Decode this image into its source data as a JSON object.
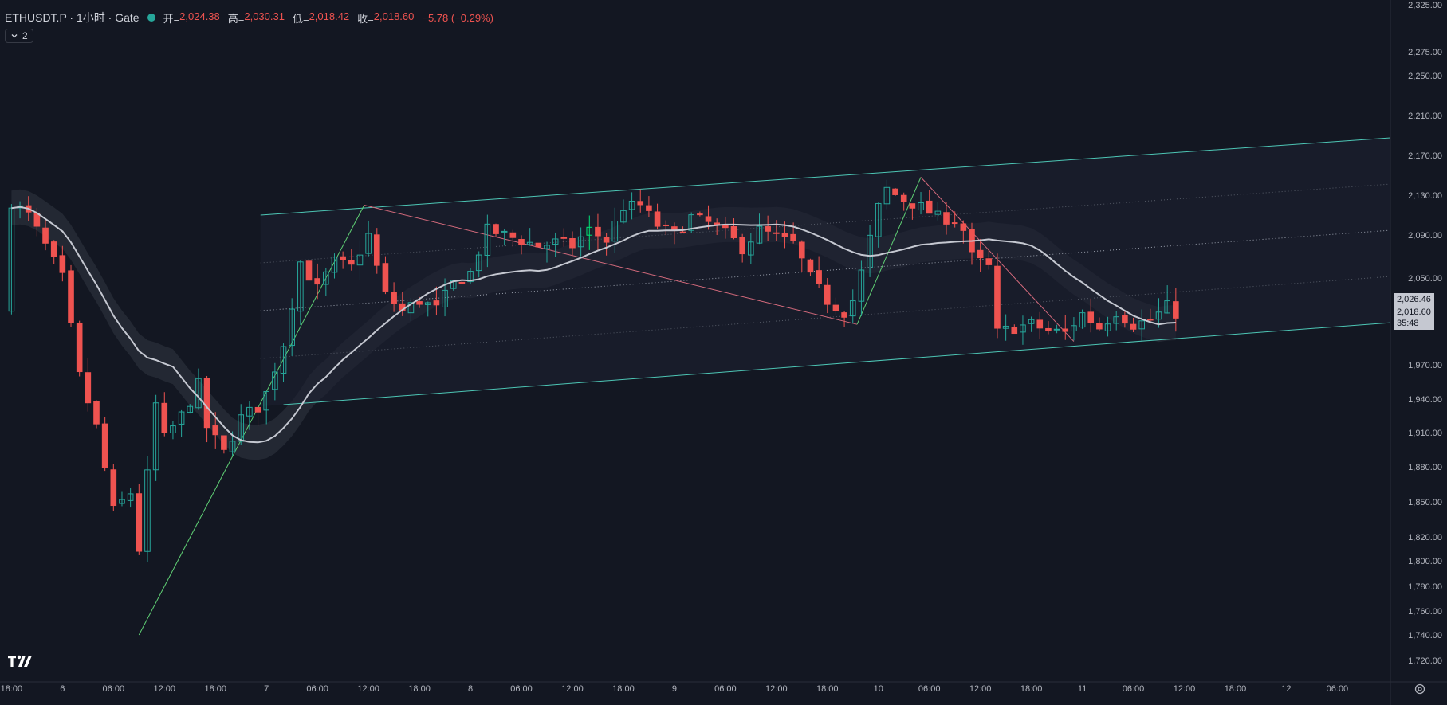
{
  "legend": {
    "symbol": "ETHUSDT.P · 1小时 · Gate",
    "open_label": "开=",
    "open": "2,024.38",
    "high_label": "高=",
    "high": "2,030.31",
    "low_label": "低=",
    "low": "2,018.42",
    "close_label": "收=",
    "close": "2,018.60",
    "change": "−5.78 (−0.29%)",
    "status_color": "#26a69a"
  },
  "indicator_toggle": {
    "icon": "chevron-down-icon",
    "count": "2"
  },
  "price_tags": {
    "ma": "2,026.46",
    "last": "2,018.60",
    "countdown": "35:48"
  },
  "icons": {
    "logo": "tradingview-logo",
    "settings": "gear-icon"
  },
  "chart_data": {
    "type": "candlestick",
    "y_axis_ticks": [
      "2,325.00",
      "2,275.00",
      "2,250.00",
      "2,210.00",
      "2,170.00",
      "2,130.00",
      "2,090.00",
      "2,050.00",
      "2,026.46",
      "2,018.60",
      "1,970.00",
      "1,940.00",
      "1,910.00",
      "1,880.00",
      "1,850.00",
      "1,820.00",
      "1,800.00",
      "1,780.00",
      "1,760.00",
      "1,740.00",
      "1,720.00"
    ],
    "y_axis_tick_values": [
      2325,
      2275,
      2250,
      2210,
      2170,
      2130,
      2090,
      2050,
      2026.46,
      2018.6,
      1970,
      1940,
      1910,
      1880,
      1850,
      1820,
      1800,
      1780,
      1760,
      1740,
      1720
    ],
    "x_axis_ticks": [
      "18:00",
      "6",
      "06:00",
      "12:00",
      "18:00",
      "7",
      "06:00",
      "12:00",
      "18:00",
      "8",
      "06:00",
      "12:00",
      "18:00",
      "9",
      "06:00",
      "12:00",
      "18:00",
      "10",
      "06:00",
      "12:00",
      "18:00",
      "11",
      "06:00",
      "12:00",
      "18:00",
      "12",
      "06:00"
    ],
    "x_axis_tick_hours": [
      -6,
      0,
      6,
      12,
      18,
      24,
      30,
      36,
      42,
      48,
      54,
      60,
      66,
      72,
      78,
      84,
      90,
      96,
      102,
      108,
      114,
      120,
      126,
      132,
      138,
      144,
      150
    ],
    "x_range_hours": [
      -6.6,
      157
    ],
    "colors": {
      "up": "#26a69a",
      "down": "#ef5350",
      "up_highlight": "#00e676",
      "ma": "#c5c8d1",
      "channel": "#4dc6b5",
      "wave_up": "#5fcf74",
      "wave_down": "#d46a7c"
    },
    "anchors": [
      {
        "h": -6.6,
        "p": 2127
      },
      {
        "h": -4,
        "p": 2110
      },
      {
        "h": -2,
        "p": 2080
      },
      {
        "h": 0,
        "p": 2050
      },
      {
        "h": 2,
        "p": 1960
      },
      {
        "h": 4,
        "p": 1915
      },
      {
        "h": 6,
        "p": 1842
      },
      {
        "h": 8,
        "p": 1858
      },
      {
        "h": 9,
        "p": 1810
      },
      {
        "h": 11,
        "p": 1935
      },
      {
        "h": 12,
        "p": 1905
      },
      {
        "h": 14,
        "p": 1925
      },
      {
        "h": 16,
        "p": 1952
      },
      {
        "h": 17,
        "p": 1915
      },
      {
        "h": 19,
        "p": 1892
      },
      {
        "h": 21,
        "p": 1923
      },
      {
        "h": 23,
        "p": 1933
      },
      {
        "h": 24,
        "p": 1945
      },
      {
        "h": 26,
        "p": 1990
      },
      {
        "h": 28,
        "p": 2065
      },
      {
        "h": 30,
        "p": 2040
      },
      {
        "h": 32,
        "p": 2065
      },
      {
        "h": 34,
        "p": 2060
      },
      {
        "h": 36,
        "p": 2090
      },
      {
        "h": 37,
        "p": 2060
      },
      {
        "h": 38,
        "p": 2035
      },
      {
        "h": 40,
        "p": 2020
      },
      {
        "h": 42,
        "p": 2030
      },
      {
        "h": 44,
        "p": 2022
      },
      {
        "h": 46,
        "p": 2045
      },
      {
        "h": 48,
        "p": 2055
      },
      {
        "h": 50,
        "p": 2095
      },
      {
        "h": 52,
        "p": 2090
      },
      {
        "h": 54,
        "p": 2085
      },
      {
        "h": 56,
        "p": 2080
      },
      {
        "h": 58,
        "p": 2083
      },
      {
        "h": 60,
        "p": 2080
      },
      {
        "h": 62,
        "p": 2095
      },
      {
        "h": 64,
        "p": 2085
      },
      {
        "h": 66,
        "p": 2118
      },
      {
        "h": 68,
        "p": 2120
      },
      {
        "h": 70,
        "p": 2100
      },
      {
        "h": 72,
        "p": 2090
      },
      {
        "h": 74,
        "p": 2108
      },
      {
        "h": 76,
        "p": 2102
      },
      {
        "h": 78,
        "p": 2092
      },
      {
        "h": 80,
        "p": 2078
      },
      {
        "h": 82,
        "p": 2095
      },
      {
        "h": 84,
        "p": 2088
      },
      {
        "h": 86,
        "p": 2082
      },
      {
        "h": 88,
        "p": 2050
      },
      {
        "h": 90,
        "p": 2030
      },
      {
        "h": 92,
        "p": 2020
      },
      {
        "h": 93,
        "p": 2030
      },
      {
        "h": 94,
        "p": 2055
      },
      {
        "h": 96,
        "p": 2118
      },
      {
        "h": 97,
        "p": 2136
      },
      {
        "h": 99,
        "p": 2125
      },
      {
        "h": 101,
        "p": 2118
      },
      {
        "h": 103,
        "p": 2108
      },
      {
        "h": 105,
        "p": 2105
      },
      {
        "h": 106,
        "p": 2095
      },
      {
        "h": 107,
        "p": 2070
      },
      {
        "h": 109,
        "p": 2060
      },
      {
        "h": 110,
        "p": 2000
      },
      {
        "h": 112,
        "p": 2005
      },
      {
        "h": 114,
        "p": 2008
      },
      {
        "h": 116,
        "p": 2002
      },
      {
        "h": 118,
        "p": 2000
      },
      {
        "h": 120,
        "p": 2018
      },
      {
        "h": 122,
        "p": 2005
      },
      {
        "h": 124,
        "p": 2020
      },
      {
        "h": 126,
        "p": 2008
      },
      {
        "h": 128,
        "p": 2012
      },
      {
        "h": 130,
        "p": 2024
      },
      {
        "h": 131,
        "p": 2018.6
      }
    ],
    "highlight_candle_hours": [
      30,
      38,
      62,
      64
    ],
    "ma_band_width": 22,
    "ma_period": 20,
    "channel": {
      "upper": [
        {
          "h": 23.3,
          "p": 2110
        },
        {
          "h": 157,
          "p": 2188
        }
      ],
      "lower": [
        {
          "h": 26,
          "p": 1935
        },
        {
          "h": 157,
          "p": 2010
        }
      ],
      "x_start": 23.3,
      "inner_lines": 3
    },
    "waves": [
      {
        "from": {
          "h": 9,
          "p": 1740
        },
        "to": {
          "h": 35.5,
          "p": 2120
        },
        "dir": "up"
      },
      {
        "from": {
          "h": 35.5,
          "p": 2120
        },
        "to": {
          "h": 93.5,
          "p": 2008
        },
        "dir": "down"
      },
      {
        "from": {
          "h": 93.5,
          "p": 2008
        },
        "to": {
          "h": 101,
          "p": 2148
        },
        "dir": "up"
      },
      {
        "from": {
          "h": 101,
          "p": 2148
        },
        "to": {
          "h": 119,
          "p": 1992
        },
        "dir": "down"
      }
    ]
  }
}
